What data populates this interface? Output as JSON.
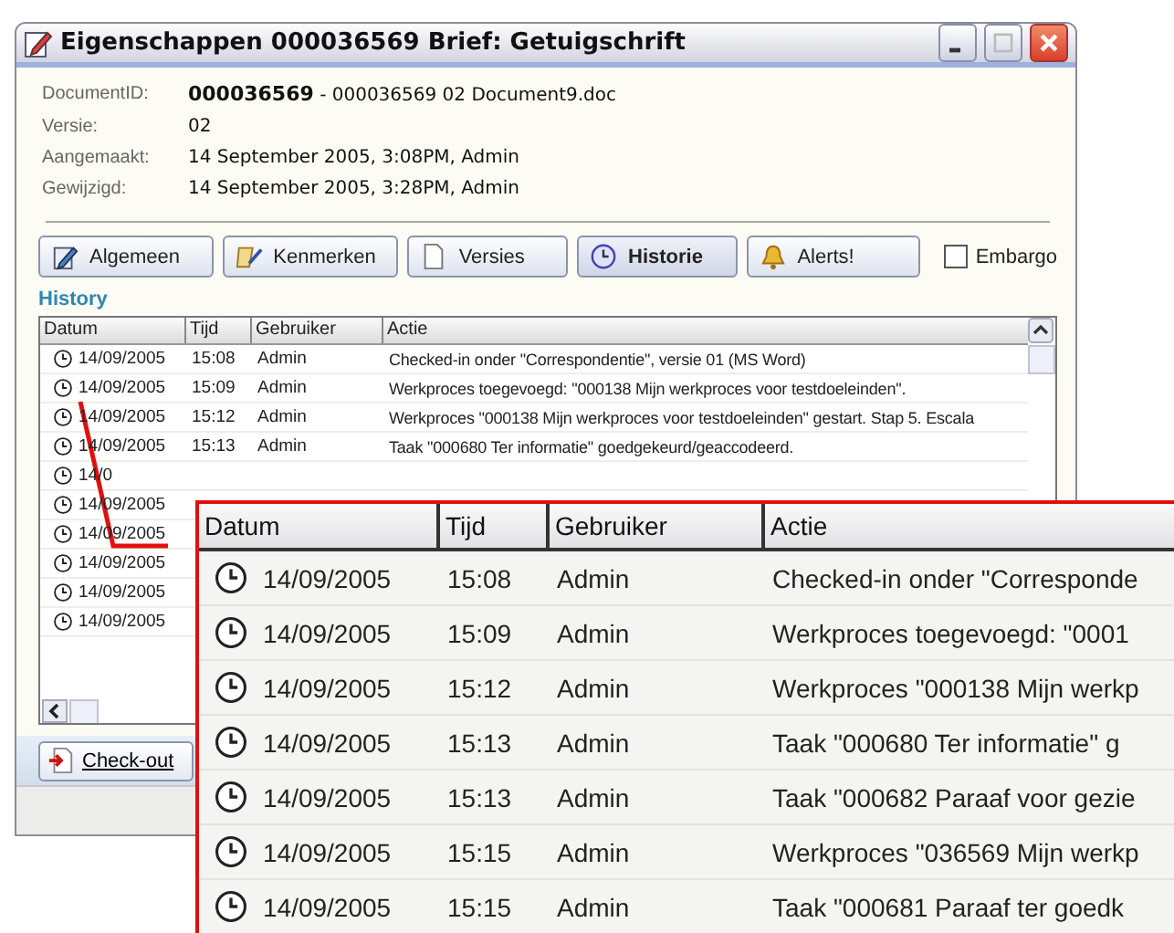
{
  "window": {
    "title": "Eigenschappen 000036569 Brief: Getuigschrift"
  },
  "fields": [
    {
      "label": "DocumentID:",
      "value": "**000036569** - 000036569 02 Document9.doc"
    },
    {
      "label": "Versie:",
      "value": "02"
    },
    {
      "label": "Aangemaakt:",
      "value": "14 September 2005,  3:08PM, Admin"
    },
    {
      "label": "Gewijzigd:",
      "value": "14 September 2005,  3:28PM, Admin"
    }
  ],
  "tabs": [
    {
      "label": "Algemeen",
      "selected": false
    },
    {
      "label": "Kenmerken",
      "selected": false
    },
    {
      "label": "Versies",
      "selected": false
    },
    {
      "label": "Historie",
      "selected": true
    },
    {
      "label": "Alerts!",
      "selected": false
    }
  ],
  "embargo": {
    "label": "Embargo",
    "checked": false
  },
  "section_title": "History",
  "table": {
    "columns": [
      "Datum",
      "Tijd",
      "Gebruiker",
      "Actie"
    ],
    "rows": [
      {
        "date": "14/09/2005",
        "time": "15:08",
        "user": "Admin",
        "action": "Checked-in onder \"Correspondentie\", versie 01 (MS Word)"
      },
      {
        "date": "14/09/2005",
        "time": "15:09",
        "user": "Admin",
        "action": "Werkproces toegevoegd: \"000138 Mijn werkproces voor testdoeleinden\"."
      },
      {
        "date": "14/09/2005",
        "time": "15:12",
        "user": "Admin",
        "action": "Werkproces \"000138 Mijn werkproces voor testdoeleinden\" gestart. Stap 5. Escala"
      },
      {
        "date": "14/09/2005",
        "time": "15:13",
        "user": "Admin",
        "action": "Taak \"000680 Ter informatie\" goedgekeurd/geaccodeerd."
      },
      {
        "date": "14/0"
      },
      {
        "date": "14/09/2005"
      },
      {
        "date": "14/09/2005"
      },
      {
        "date": "14/09/2005"
      },
      {
        "date": "14/09/2005"
      },
      {
        "date": "14/09/2005"
      }
    ]
  },
  "checkout_button": "Check-out",
  "callout": {
    "columns": [
      "Datum",
      "Tijd",
      "Gebruiker",
      "Actie"
    ],
    "rows": [
      {
        "date": "14/09/2005",
        "time": "15:08",
        "user": "Admin",
        "action": "Checked-in onder \"Corresponde"
      },
      {
        "date": "14/09/2005",
        "time": "15:09",
        "user": "Admin",
        "action": "Werkproces toegevoegd: \"0001"
      },
      {
        "date": "14/09/2005",
        "time": "15:12",
        "user": "Admin",
        "action": "Werkproces \"000138 Mijn werkp"
      },
      {
        "date": "14/09/2005",
        "time": "15:13",
        "user": "Admin",
        "action": "Taak \"000680 Ter informatie\" g"
      },
      {
        "date": "14/09/2005",
        "time": "15:13",
        "user": "Admin",
        "action": "Taak \"000682 Paraaf voor gezie"
      },
      {
        "date": "14/09/2005",
        "time": "15:15",
        "user": "Admin",
        "action": "Werkproces \"036569 Mijn werkp"
      },
      {
        "date": "14/09/2005",
        "time": "15:15",
        "user": "Admin",
        "action": "Taak \"000681 Paraaf ter goedk"
      }
    ]
  }
}
